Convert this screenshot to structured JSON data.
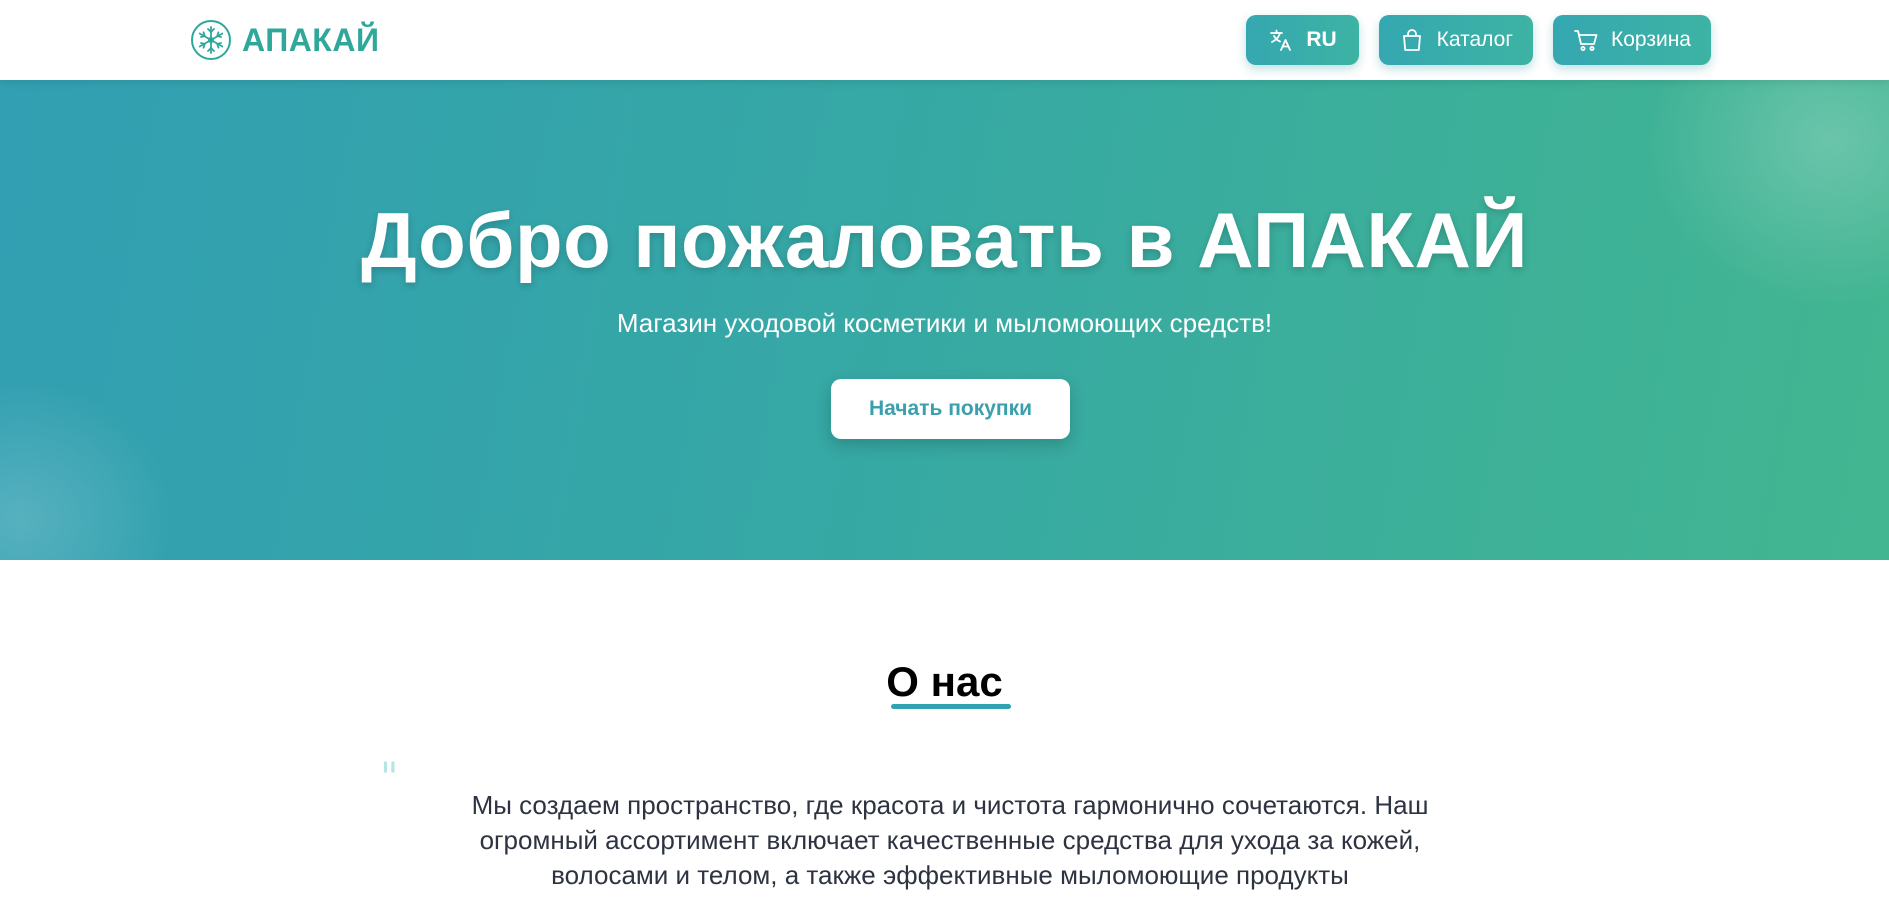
{
  "header": {
    "logo_text": "АПАКАЙ",
    "logo_icon": "snowflake-icon",
    "nav": {
      "lang_label": "RU",
      "catalog_label": "Каталог",
      "cart_label": "Корзина"
    }
  },
  "hero": {
    "title": "Добро пожаловать в АПАКАЙ",
    "subtitle": "Магазин уходовой косметики и мыломоющих средств!",
    "cta_label": "Начать покупки"
  },
  "about": {
    "title": "О нас",
    "quote_mark": "\"",
    "text": "Мы создаем пространство, где красота и чистота гармонично сочетаются. Наш огромный ассортимент включает качественные средства для ухода за кожей, волосами и телом, а также эффективные мыломоющие продукты"
  },
  "colors": {
    "accent": "#2fa89b",
    "hero_start": "#329fb2",
    "hero_end": "#42b690",
    "cta_text": "#3aa0ad"
  }
}
